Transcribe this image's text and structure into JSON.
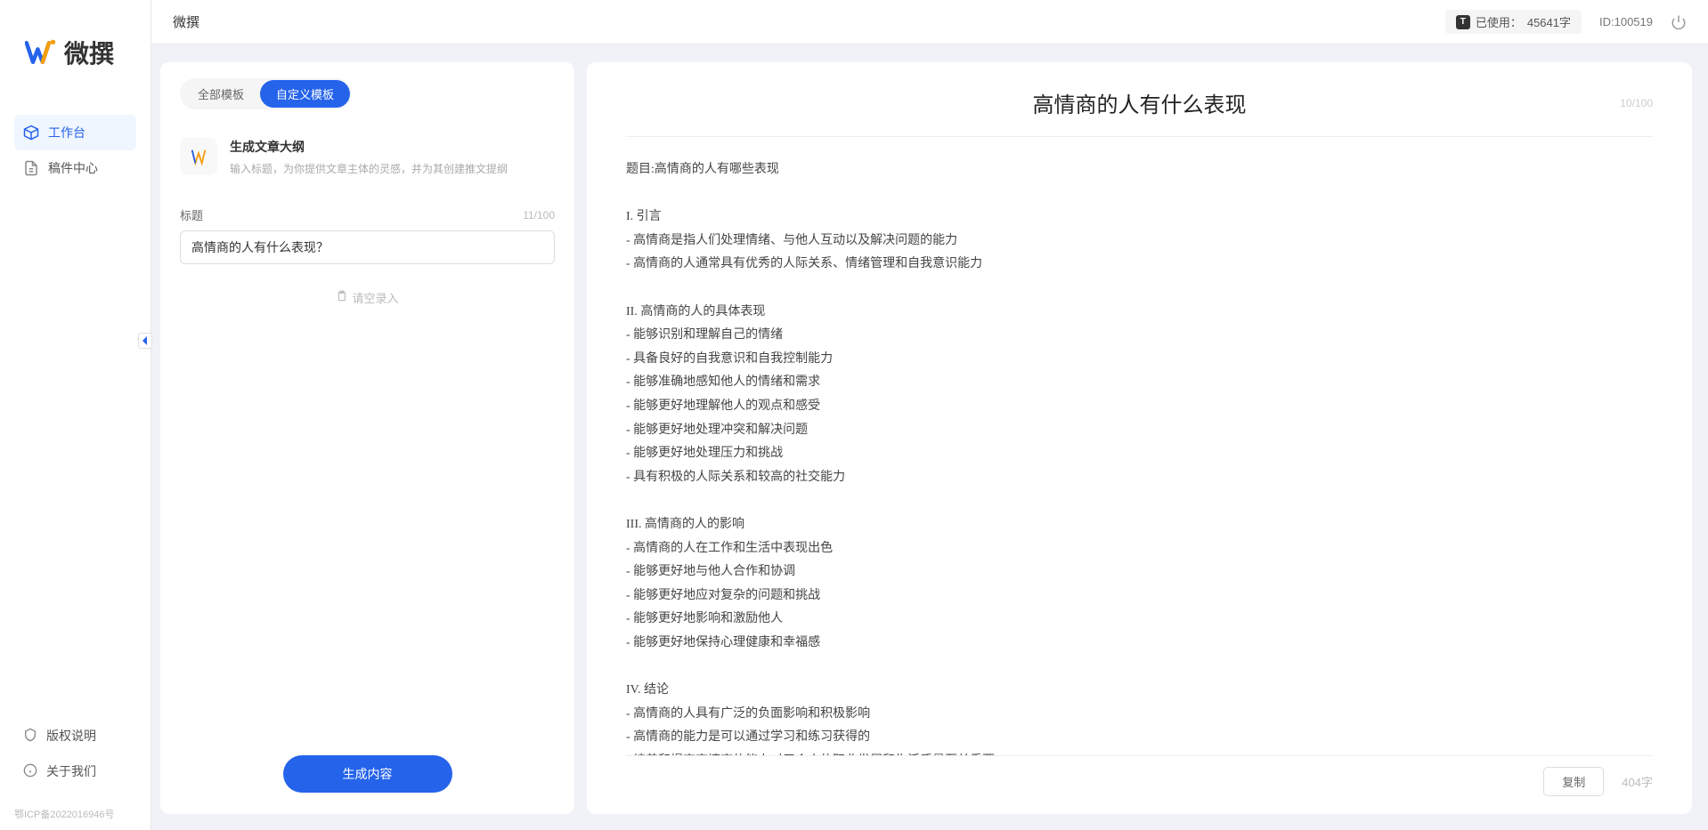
{
  "app": {
    "name": "微撰",
    "title": "微撰"
  },
  "topbar": {
    "usage_label": "已使用：",
    "usage_value": "45641字",
    "user_id_label": "ID:100519"
  },
  "sidebar": {
    "nav": [
      {
        "label": "工作台",
        "active": true
      },
      {
        "label": "稿件中心",
        "active": false
      }
    ],
    "footer": [
      {
        "label": "版权说明"
      },
      {
        "label": "关于我们"
      }
    ],
    "icp": "鄂ICP备2022016946号"
  },
  "leftPanel": {
    "tabs": [
      {
        "label": "全部模板",
        "active": false
      },
      {
        "label": "自定义模板",
        "active": true
      }
    ],
    "template": {
      "title": "生成文章大纲",
      "desc": "输入标题，为你提供文章主体的灵感，并为其创建推文提纲"
    },
    "field": {
      "label": "标题",
      "count": "11/100",
      "value": "高情商的人有什么表现？"
    },
    "emptyHint": "请空录入",
    "generateBtn": "生成内容"
  },
  "rightPanel": {
    "docTitle": "高情商的人有什么表现",
    "titleCount": "10/100",
    "body": "题目:高情商的人有哪些表现\n\nI. 引言\n- 高情商是指人们处理情绪、与他人互动以及解决问题的能力\n- 高情商的人通常具有优秀的人际关系、情绪管理和自我意识能力\n\nII. 高情商的人的具体表现\n- 能够识别和理解自己的情绪\n- 具备良好的自我意识和自我控制能力\n- 能够准确地感知他人的情绪和需求\n- 能够更好地理解他人的观点和感受\n- 能够更好地处理冲突和解决问题\n- 能够更好地处理压力和挑战\n- 具有积极的人际关系和较高的社交能力\n\nIII. 高情商的人的影响\n- 高情商的人在工作和生活中表现出色\n- 能够更好地与他人合作和协调\n- 能够更好地应对复杂的问题和挑战\n- 能够更好地影响和激励他人\n- 能够更好地保持心理健康和幸福感\n\nIV. 结论\n- 高情商的人具有广泛的负面影响和积极影响\n- 高情商的能力是可以通过学习和练习获得的\n- 培养和提高高情商的能力对于个人的职业发展和生活质量至关重要。",
    "copyBtn": "复制",
    "wordCount": "404字"
  }
}
